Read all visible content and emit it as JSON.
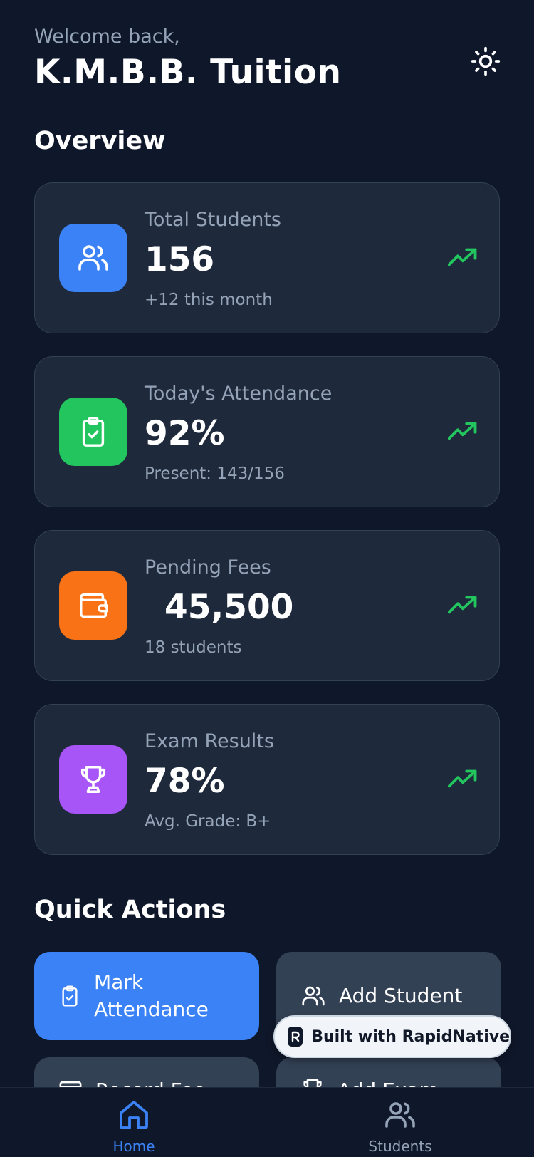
{
  "header": {
    "welcome": "Welcome back,",
    "name": "K.M.B.B. Tuition"
  },
  "overview": {
    "title": "Overview",
    "cards": [
      {
        "label": "Total Students",
        "value": "156",
        "sub": "+12 this month",
        "icon": "users-icon",
        "color": "#3b82f6"
      },
      {
        "label": "Today's Attendance",
        "value": "92%",
        "sub": "Present: 143/156",
        "icon": "clipboard-check-icon",
        "color": "#22c55e"
      },
      {
        "label": "Pending Fees",
        "value": "45,500",
        "sub": "18 students",
        "icon": "wallet-icon",
        "color": "#f97316"
      },
      {
        "label": "Exam Results",
        "value": "78%",
        "sub": "Avg. Grade: B+",
        "icon": "trophy-icon",
        "color": "#a855f7"
      }
    ],
    "trend_color": "#22c55e"
  },
  "quick_actions": {
    "title": "Quick Actions",
    "items": [
      {
        "label": "Mark Attendance",
        "icon": "clipboard-check-icon"
      },
      {
        "label": "Add Student",
        "icon": "users-icon"
      },
      {
        "label": "Record Fee",
        "icon": "card-icon"
      },
      {
        "label": "Add Exam",
        "icon": "trophy-icon"
      }
    ]
  },
  "badge": {
    "text": "Built with RapidNative"
  },
  "tabs": [
    {
      "label": "Home",
      "active": true
    },
    {
      "label": "Students",
      "active": false
    }
  ],
  "colors": {
    "accent": "#3b82f6",
    "background": "#0f172a",
    "card": "#1e293b",
    "muted": "#94a3b8"
  }
}
